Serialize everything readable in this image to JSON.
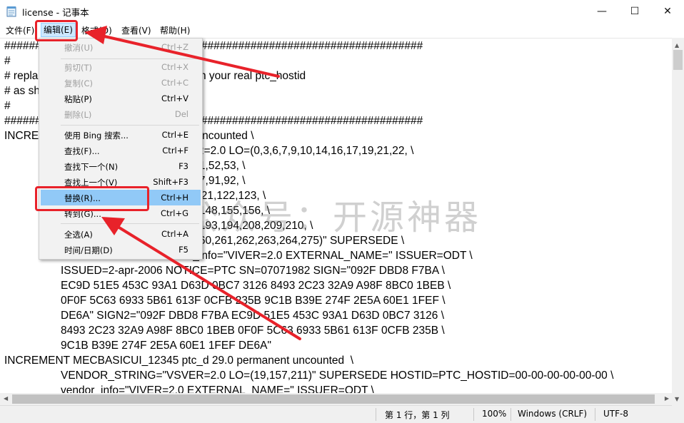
{
  "window": {
    "title": "license - 记事本",
    "minimize_glyph": "—",
    "maximize_glyph": "☐",
    "close_glyph": "✕"
  },
  "menubar": {
    "file": "文件(F)",
    "edit": "编辑(E)",
    "format": "格式(O)",
    "view": "查看(V)",
    "help": "帮助(H)"
  },
  "editor_lines": [
    "####################################################################",
    "#",
    "# replace ptc_hostid in every-feature with your real ptc_hostid",
    "# as shown ...",
    "#",
    "####################################################################",
    "INCREMENT ... ptc_d 29.0 permanent uncounted \\",
    "VENDOR_STRING=\"VSVER=2.0 LO=(0,3,6,7,9,10,14,16,17,19,21,22, \\",
    "...35,36,37,40,41,45,47,48,51,52,53, \\",
    "...65,66,67,69,71,72,73,74,77,91,92, \\",
    "...115,116,117,118,119,120,121,122,123, \\",
    "...134,135,137,139,140,141,148,155,156, \\",
    "...187,188,189,190,191,192,193,194,208,209,210, \\",
    "...22,223,224,251,253,259,260,261,262,263,264,275)\" SUPERSEDE \\",
    "...0-00-00-00-00-00 vendor_info=\"VIVER=2.0 EXTERNAL_NAME=\" ISSUER=ODT \\",
    "ISSUED=2-apr-2006 NOTICE=PTC SN=07071982 SIGN=\"092F DBD8 F7BA \\",
    "EC9D 51E5 453C 93A1 D63D 0BC7 3126 8493 2C23 32A9 A98F 8BC0 1BEB \\",
    "0F0F 5C63 6933 5B61 613F 0CFB 235B 9C1B B39E 274F 2E5A 60E1 1FEF \\",
    "DE6A\" SIGN2=\"092F DBD8 F7BA EC9D 51E5 453C 93A1 D63D 0BC7 3126 \\",
    "8493 2C23 32A9 A98F 8BC0 1BEB 0F0F 5C63 6933 5B61 613F 0CFB 235B \\",
    "9C1B B39E 274F 2E5A 60E1 1FEF DE6A\"",
    "INCREMENT MECBASICUI_12345 ptc_d 29.0 permanent uncounted  \\",
    "VENDOR_STRING=\"VSVER=2.0 LO=(19,157,211)\" SUPERSEDE HOSTID=PTC_HOSTID=00-00-00-00-00-00 \\",
    "vendor_info=\"VIVER=2.0 EXTERNAL_NAME=\" ISSUER=ODT \\"
  ],
  "edit_menu": [
    {
      "label": "撤消(U)",
      "shortcut": "Ctrl+Z",
      "disabled": true
    },
    {
      "label": "剪切(T)",
      "shortcut": "Ctrl+X",
      "disabled": true
    },
    {
      "label": "复制(C)",
      "shortcut": "Ctrl+C",
      "disabled": true
    },
    {
      "label": "粘贴(P)",
      "shortcut": "Ctrl+V",
      "disabled": false
    },
    {
      "label": "删除(L)",
      "shortcut": "Del",
      "disabled": true
    },
    {
      "label": "使用 Bing 搜索...",
      "shortcut": "Ctrl+E",
      "disabled": false
    },
    {
      "label": "查找(F)...",
      "shortcut": "Ctrl+F",
      "disabled": false
    },
    {
      "label": "查找下一个(N)",
      "shortcut": "F3",
      "disabled": false
    },
    {
      "label": "查找上一个(V)",
      "shortcut": "Shift+F3",
      "disabled": false
    },
    {
      "label": "替换(R)...",
      "shortcut": "Ctrl+H",
      "disabled": false,
      "highlighted": true
    },
    {
      "label": "转到(G)...",
      "shortcut": "Ctrl+G",
      "disabled": false
    },
    {
      "label": "全选(A)",
      "shortcut": "Ctrl+A",
      "disabled": false
    },
    {
      "label": "时间/日期(D)",
      "shortcut": "F5",
      "disabled": false
    }
  ],
  "statusbar": {
    "position": "第 1 行，第 1 列",
    "zoom": "100%",
    "line_ending": "Windows (CRLF)",
    "encoding": "UTF-8"
  },
  "watermark": "公众号：开源神器",
  "colors": {
    "annotation_red": "#e8222a",
    "menu_highlight": "#91c9f7",
    "menu_active": "#cce8ff"
  }
}
